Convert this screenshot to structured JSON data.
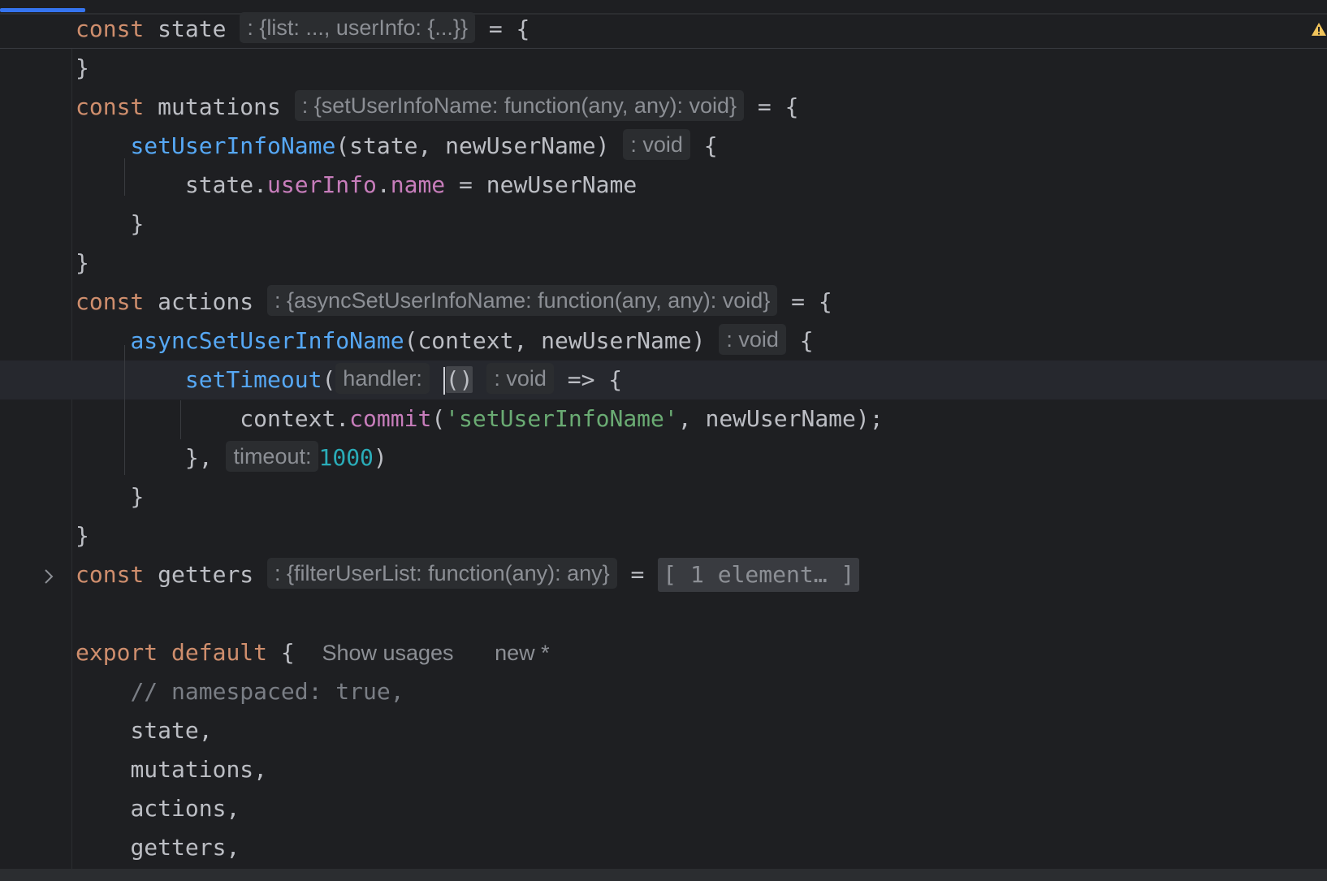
{
  "editor": {
    "line1": {
      "kw": "const",
      "name": " state",
      "hint": ": {list: ..., userInfo: {...}}",
      "rest": " = {"
    },
    "line2": {
      "text": "}"
    },
    "line3": {
      "kw": "const",
      "name": " mutations",
      "hint": ": {setUserInfoName: function(any, any): void}",
      "rest": " = {"
    },
    "line4": {
      "fn": "setUserInfoName",
      "args": "(state, newUserName)",
      "hint": ": void",
      "rest": " {"
    },
    "line5": {
      "obj": "state.",
      "prop1": "userInfo",
      "dot": ".",
      "prop2": "name",
      "rest": " = newUserName"
    },
    "line6": {
      "text": "}"
    },
    "line7": {
      "text": "}"
    },
    "line8": {
      "kw": "const",
      "name": " actions",
      "hint": ": {asyncSetUserInfoName: function(any, any): void}",
      "rest": " = {"
    },
    "line9": {
      "fn": "asyncSetUserInfoName",
      "args": "(context, newUserName)",
      "hint": ": void",
      "rest": " {"
    },
    "line10": {
      "fn": "setTimeout",
      "open": "(",
      "hint_param": "handler:",
      "parens": "()",
      "hint_type": ": void",
      "rest": " => {"
    },
    "line11": {
      "obj": "context.",
      "method": "commit",
      "open": "(",
      "str": "'setUserInfoName'",
      "rest": ", newUserName);"
    },
    "line12": {
      "text": "},",
      "hint_param": "timeout:",
      "num": "1000",
      "close": ")"
    },
    "line13": {
      "text": "}"
    },
    "line14": {
      "text": "}"
    },
    "line15": {
      "kw": "const",
      "name": " getters",
      "hint": ": {filterUserList: function(any): any}",
      "eq": " = ",
      "folded": "[ 1 element… ]"
    },
    "line17": {
      "kw1": "export",
      "kw2": " default",
      "rest": " {",
      "usages": "Show usages",
      "new_label": "new *"
    },
    "line18": {
      "comment": "// namespaced: true,"
    },
    "line19": {
      "text": "state,"
    },
    "line20": {
      "text": "mutations,"
    },
    "line21": {
      "text": "actions,"
    },
    "line22": {
      "text": "getters,"
    }
  },
  "icons": {
    "fold": "chevron-right-icon",
    "warning": "warning-icon"
  },
  "colors": {
    "background": "#1e1f22",
    "keyword": "#cf8e6d",
    "function": "#56a8f5",
    "property": "#c77dbb",
    "string": "#6aab73",
    "number": "#2aacb8",
    "comment": "#7a7e85",
    "text": "#bcbec4",
    "accent": "#3574f0",
    "warning": "#f2c55c"
  }
}
